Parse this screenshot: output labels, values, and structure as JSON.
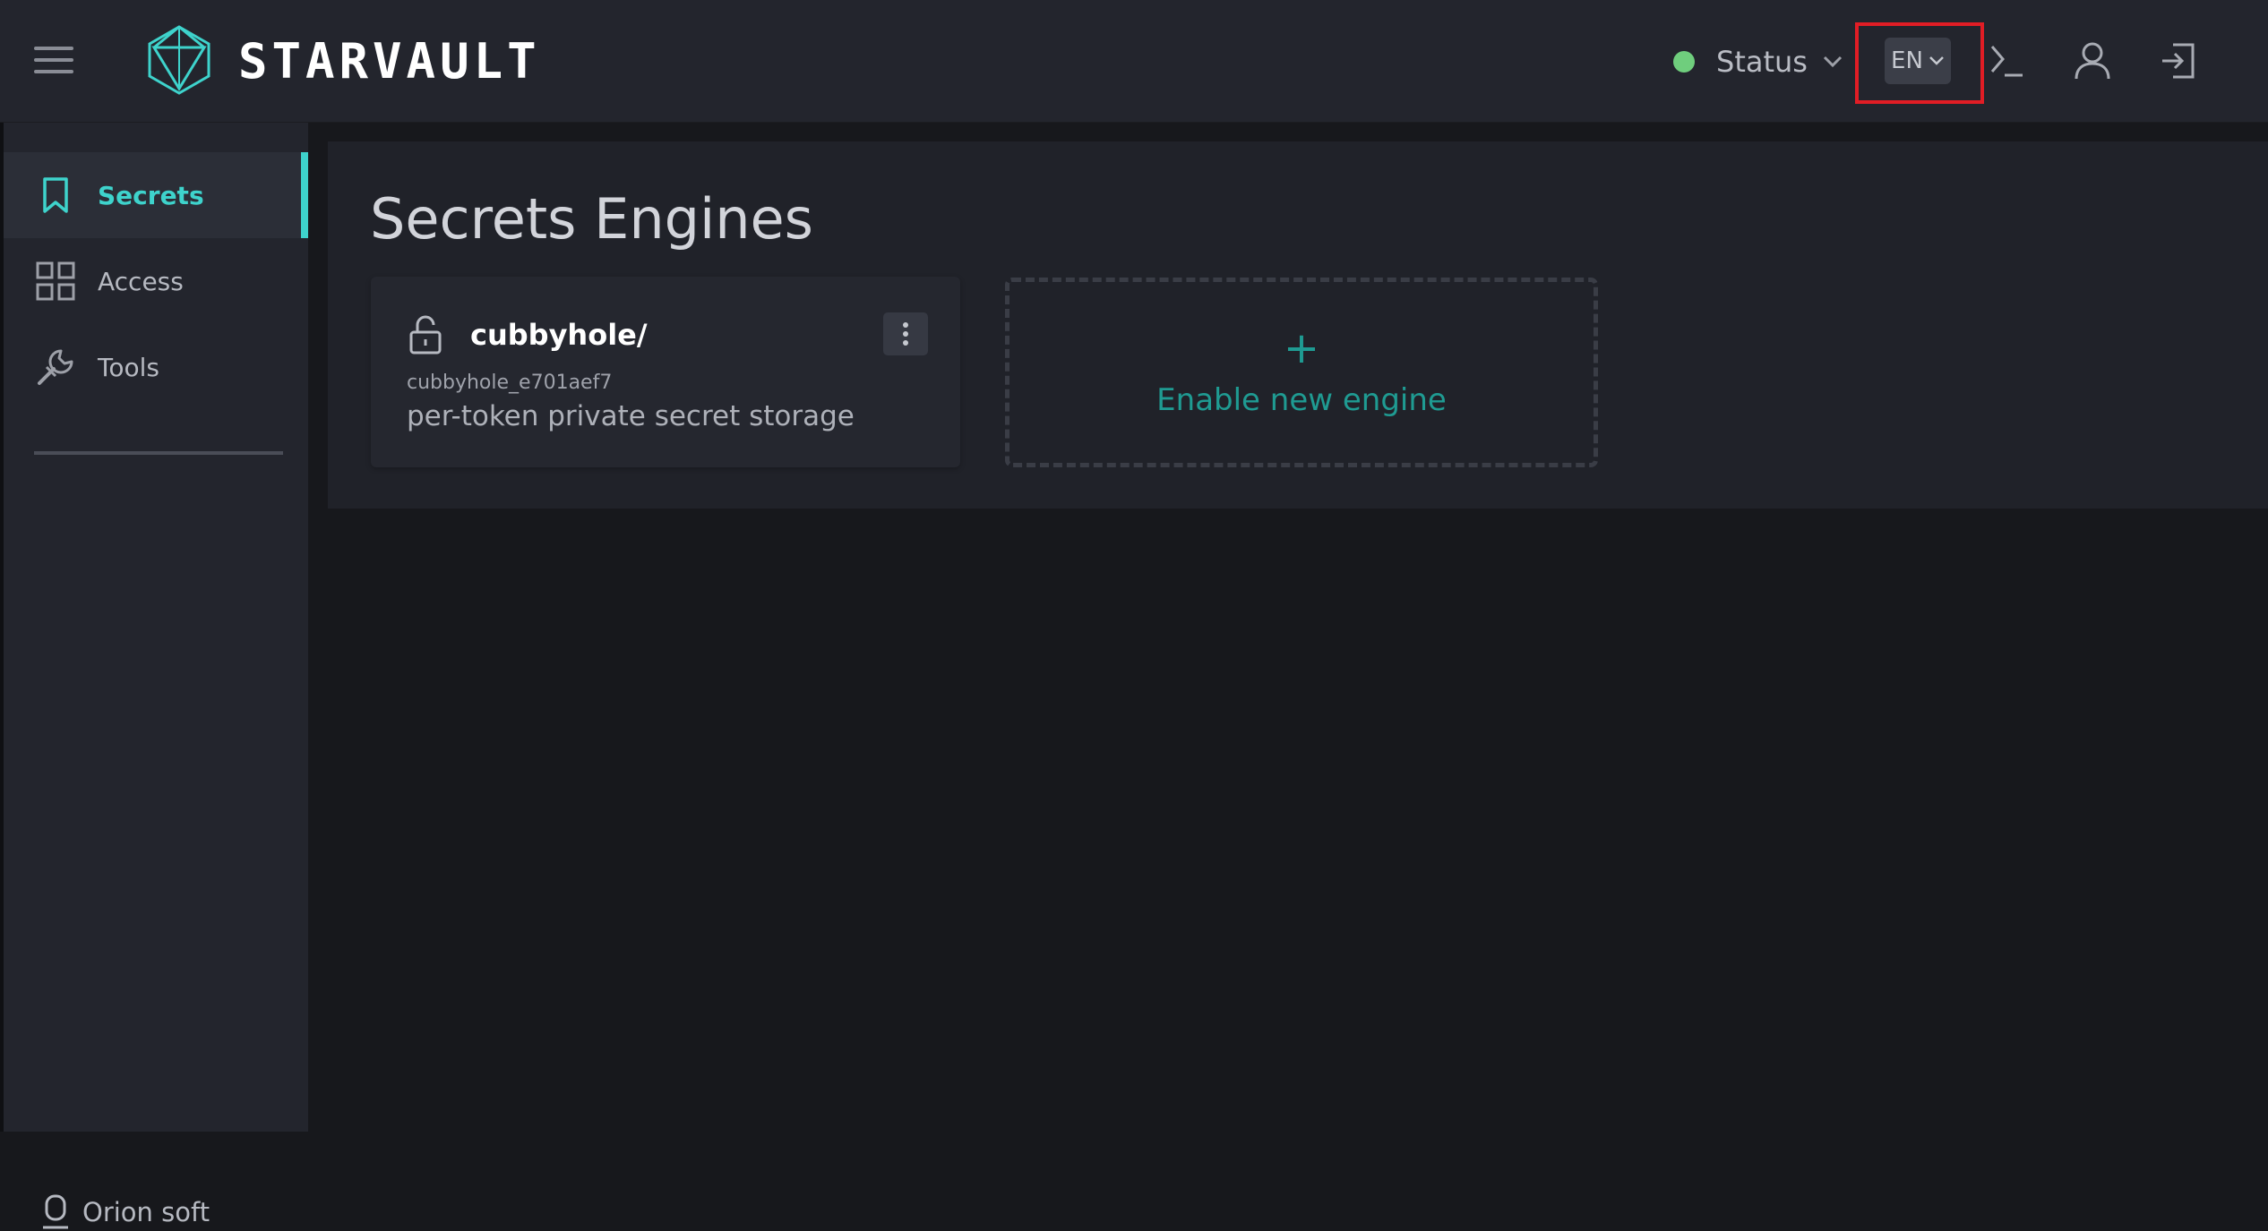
{
  "header": {
    "menu_icon": "hamburger-menu-icon",
    "logo_icon": "geometric-logo-icon",
    "brand_name": "STARVAULT",
    "status_label": "Status",
    "status_color": "#6fce7d",
    "language": "EN",
    "icons": [
      "console-icon",
      "user-icon",
      "logout-icon"
    ]
  },
  "sidebar": {
    "items": [
      {
        "label": "Secrets",
        "icon": "bookmark-icon",
        "active": true
      },
      {
        "label": "Access",
        "icon": "grid-icon",
        "active": false
      },
      {
        "label": "Tools",
        "icon": "wrench-icon",
        "active": false
      }
    ],
    "footer_label": "Orion soft",
    "footer_icon": "orion-logo-icon"
  },
  "main": {
    "title": "Secrets Engines",
    "engines": [
      {
        "name": "cubbyhole/",
        "id": "cubbyhole_e701aef7",
        "description": "per-token private secret storage",
        "icon": "unlocked-padlock-icon"
      }
    ],
    "enable_plus": "+",
    "enable_label": "Enable new engine"
  },
  "colors": {
    "accent": "#3ed3cc",
    "accent_dark": "#1f9b92",
    "highlight": "#e11d25"
  }
}
